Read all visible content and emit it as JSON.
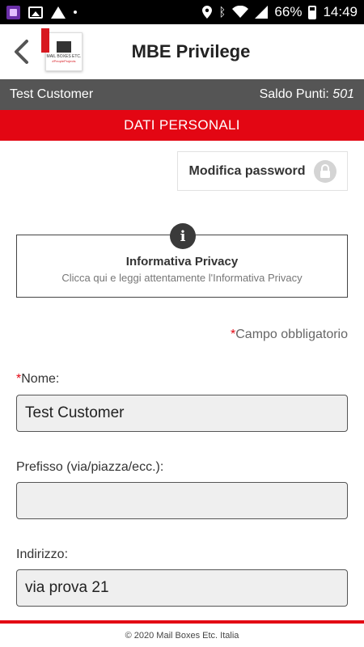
{
  "status_bar": {
    "battery": "66%",
    "time": "14:49"
  },
  "header": {
    "title": "MBE Privilege",
    "logo_text": "MAIL BOXES ETC.",
    "logo_sub": "#PeopleProjects"
  },
  "customer": {
    "name": "Test Customer",
    "points_label": "Saldo Punti:",
    "points_value": "501"
  },
  "section": {
    "title": "DATI PERSONALI"
  },
  "password_button": {
    "label": "Modifica password"
  },
  "privacy": {
    "title": "Informativa Privacy",
    "subtitle": "Clicca qui e leggi attentamente l'Informativa Privacy",
    "icon_letter": "i"
  },
  "required_note": {
    "marker": "*",
    "text": "Campo obbligatorio"
  },
  "fields": [
    {
      "label": "Nome:",
      "required": true,
      "value": "Test Customer",
      "marker": "*"
    },
    {
      "label": "Prefisso (via/piazza/ecc.):",
      "required": false,
      "value": ""
    },
    {
      "label": "Indirizzo:",
      "required": false,
      "value": "via prova 21"
    }
  ],
  "footer": {
    "text": "© 2020 Mail Boxes Etc. Italia"
  },
  "colors": {
    "brand_red": "#e30613",
    "customer_bar": "#555555",
    "input_bg": "#efefef"
  }
}
